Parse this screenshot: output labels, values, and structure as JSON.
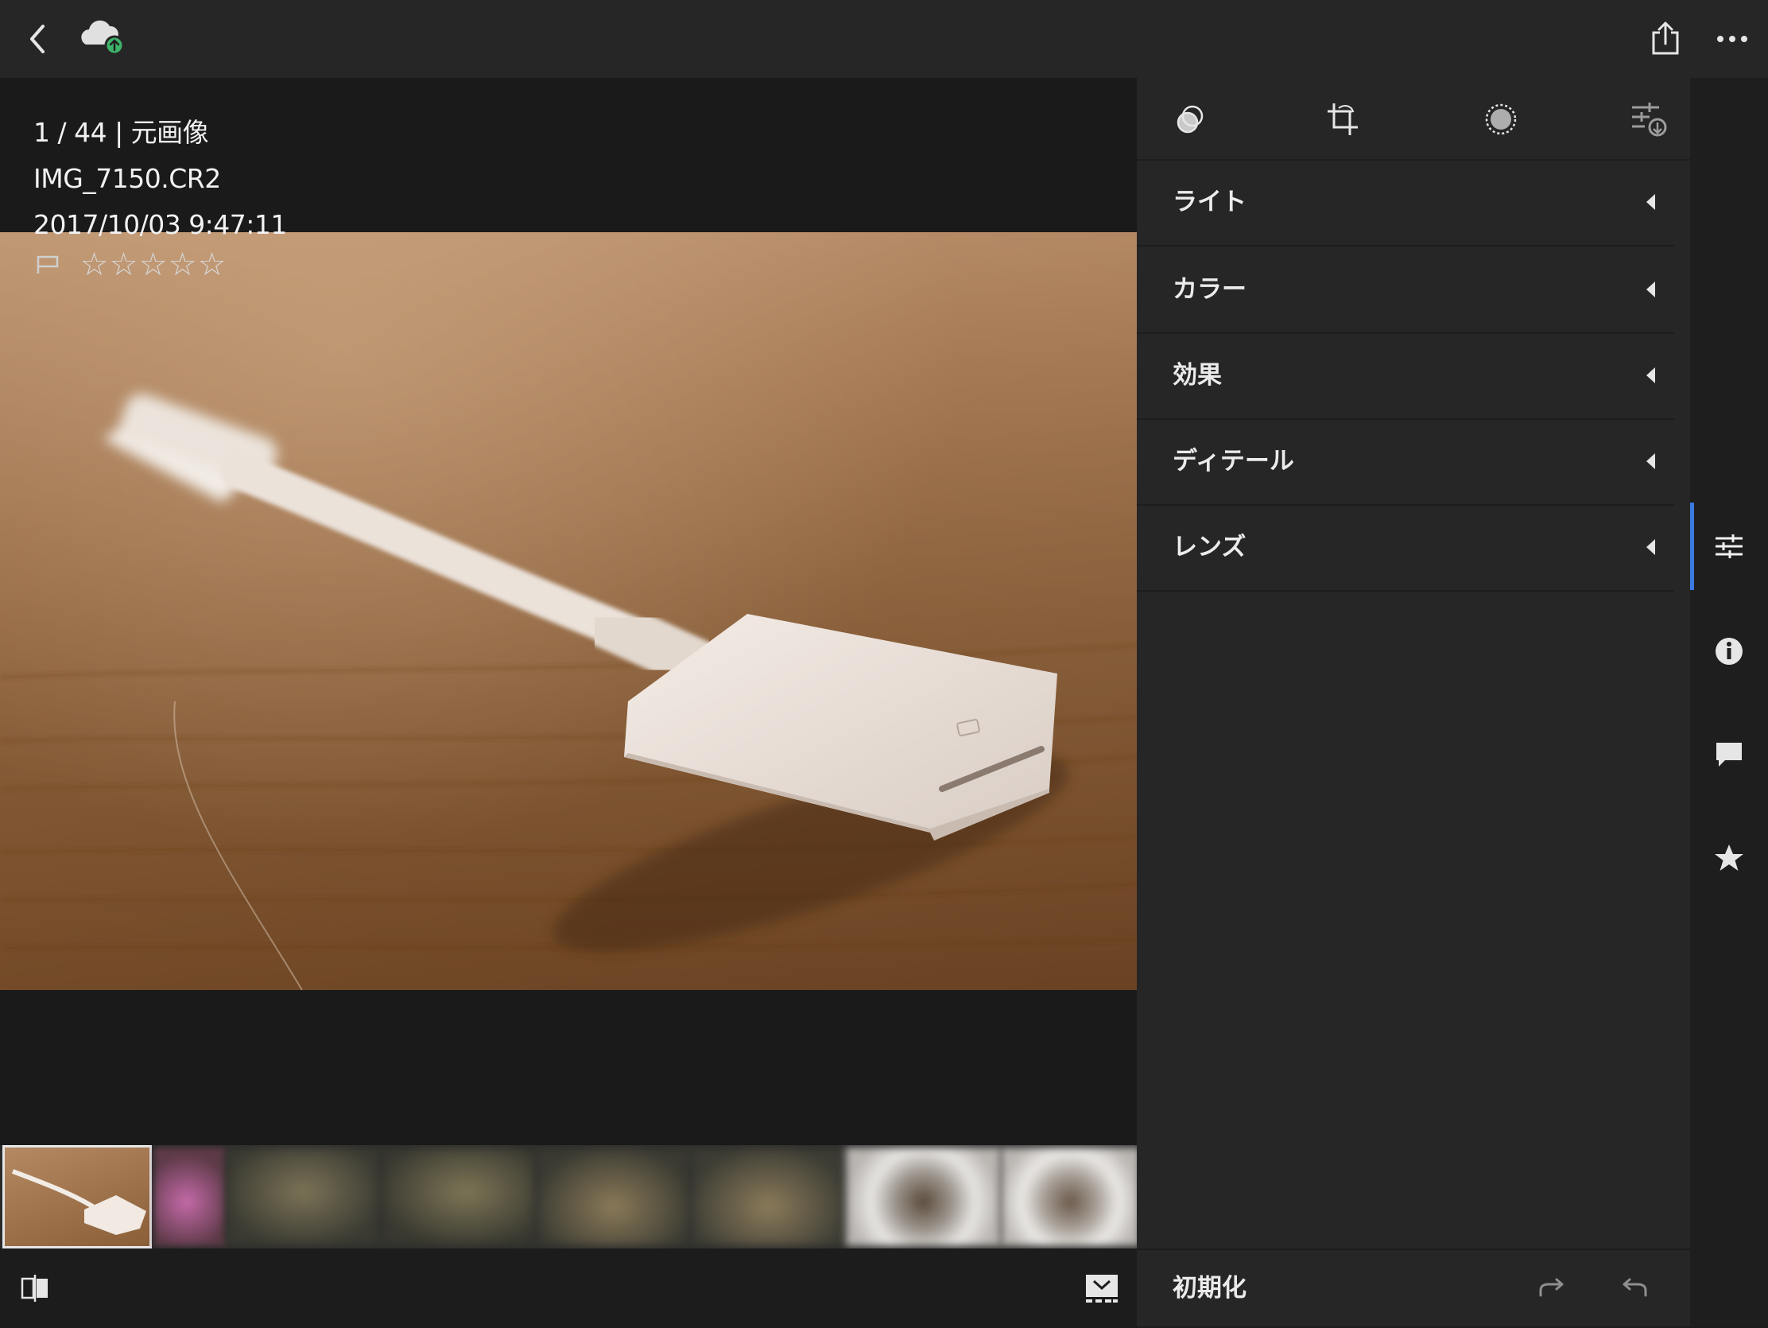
{
  "topbar": {
    "back_icon": "chevron-left-icon",
    "cloud_icon": "cloud-sync-icon",
    "share_icon": "share-icon",
    "more_icon": "more-dots-icon"
  },
  "viewer": {
    "position_line": "1 / 44 | 元画像",
    "filename": "IMG_7150.CR2",
    "datetime": "2017/10/03 9:47:11",
    "flag_icon": "flag-icon",
    "rating": 0,
    "max_rating": 5,
    "star_glyph": "☆"
  },
  "filmstrip": {
    "selected_index": 0,
    "thumb_count": 8,
    "compare_icon": "before-after-icon",
    "filmstrip_toggle_icon": "filmstrip-toggle-icon"
  },
  "panel": {
    "tools": [
      "presets-icon",
      "crop-icon",
      "selective-icon",
      "adjust-add-icon"
    ],
    "sections": [
      {
        "label": "ライト"
      },
      {
        "label": "カラー"
      },
      {
        "label": "効果"
      },
      {
        "label": "ディテール"
      },
      {
        "label": "レンズ"
      }
    ],
    "reset_label": "初期化",
    "redo_icon": "redo-icon",
    "undo_icon": "undo-icon"
  },
  "rail": {
    "items": [
      "edit-sliders-icon",
      "info-icon",
      "comment-icon",
      "star-icon"
    ],
    "active_index": 0,
    "accent": "#3b7ae0"
  },
  "colors": {
    "topbar_bg": "#262626",
    "panel_bg": "#262626",
    "viewer_bg": "#1a1a1a",
    "cloud_badge": "#3db36a"
  }
}
